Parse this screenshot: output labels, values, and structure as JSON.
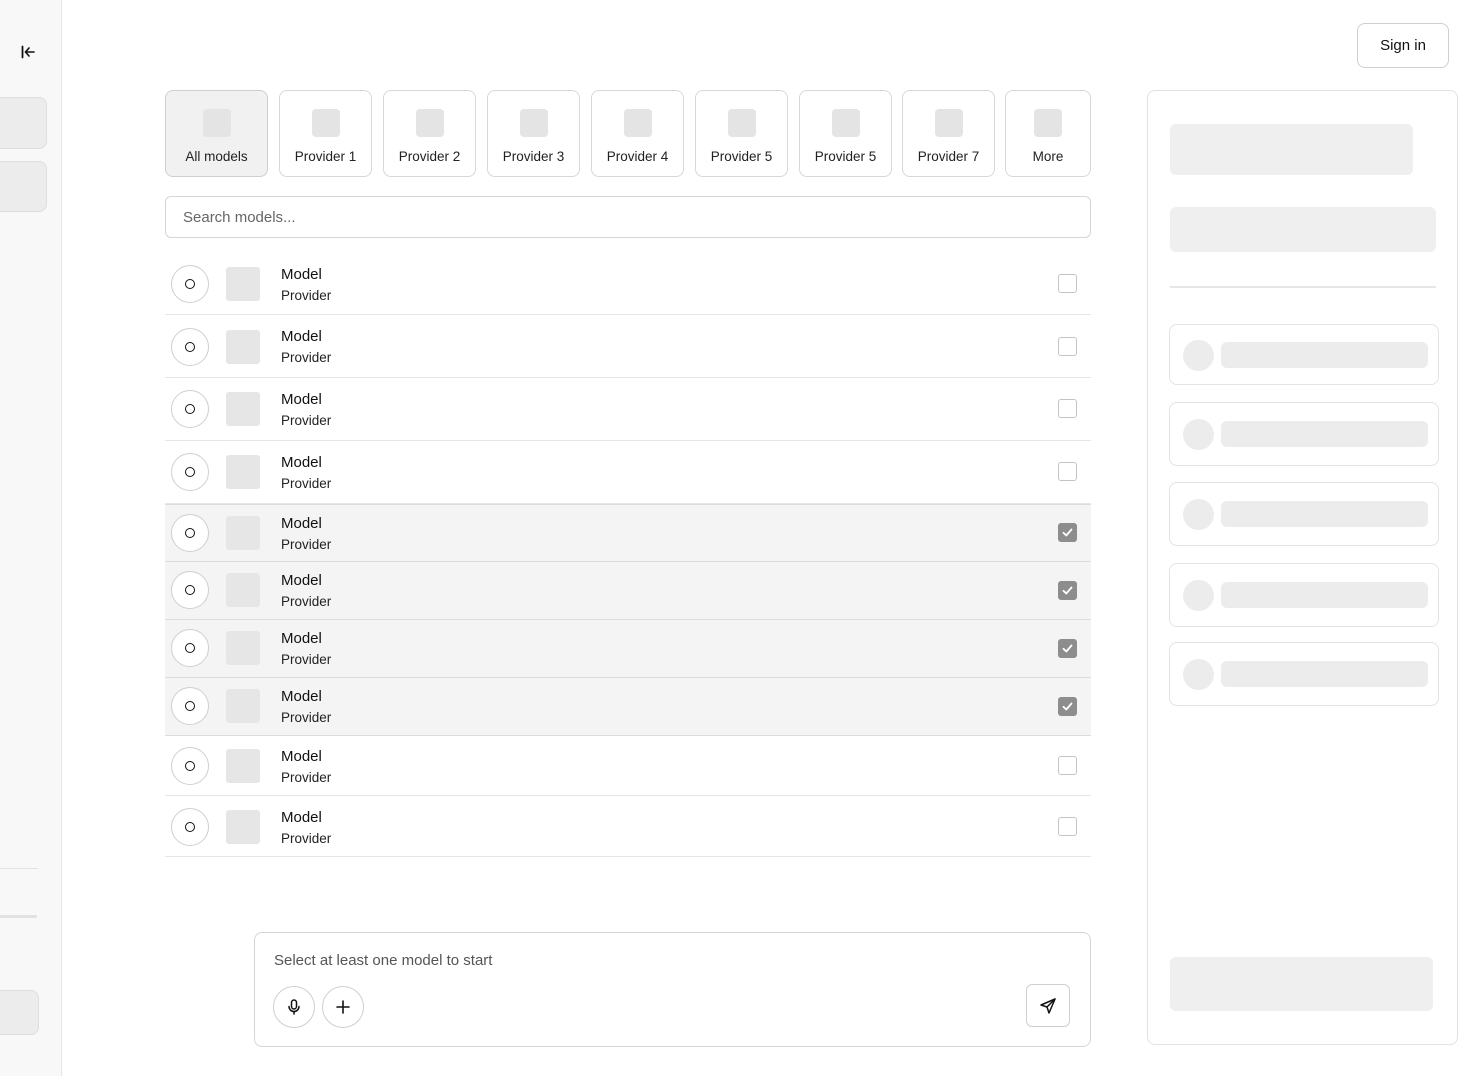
{
  "header": {
    "signin_label": "Sign in"
  },
  "providers": [
    "All models",
    "Provider 1",
    "Provider 2",
    "Provider 3",
    "Provider 4",
    "Provider 5",
    "Provider 5",
    "Provider 7",
    "More"
  ],
  "search": {
    "placeholder": "Search models..."
  },
  "models": [
    {
      "name": "Model",
      "provider": "Provider",
      "checked": false
    },
    {
      "name": "Model",
      "provider": "Provider",
      "checked": false
    },
    {
      "name": "Model",
      "provider": "Provider",
      "checked": false
    },
    {
      "name": "Model",
      "provider": "Provider",
      "checked": false
    },
    {
      "name": "Model",
      "provider": "Provider",
      "checked": true
    },
    {
      "name": "Model",
      "provider": "Provider",
      "checked": true
    },
    {
      "name": "Model",
      "provider": "Provider",
      "checked": true
    },
    {
      "name": "Model",
      "provider": "Provider",
      "checked": true
    },
    {
      "name": "Model",
      "provider": "Provider",
      "checked": false
    },
    {
      "name": "Model",
      "provider": "Provider",
      "checked": false
    }
  ],
  "composer": {
    "placeholder": "Select at least one model to start"
  },
  "icons": {
    "collapse": "collapse-sidebar-icon",
    "radio": "radio-circle-icon",
    "check": "checkmark-icon",
    "mic": "microphone-icon",
    "add": "plus-icon",
    "send": "send-icon"
  }
}
